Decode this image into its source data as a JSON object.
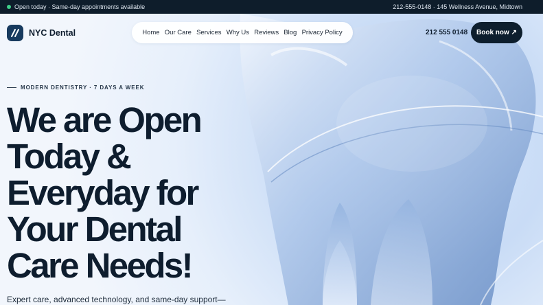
{
  "topbar": {
    "status": "Open today · Same-day appointments available",
    "contact": "212-555-0148 · 145 Wellness Avenue, Midtown"
  },
  "brand": {
    "name": "NYC Dental"
  },
  "nav": {
    "links": [
      "Home",
      "Our Care",
      "Services",
      "Why Us",
      "Reviews",
      "Blog",
      "Privacy Policy"
    ]
  },
  "header": {
    "phone": "212 555 0148",
    "book_label": "Book now ↗"
  },
  "hero": {
    "eyebrow": "MODERN DENTISTRY · 7 DAYS A WEEK",
    "headline": "We are Open Today & Everyday for Your Dental Care Needs!",
    "subtext": "Expert care, advanced technology, and same-day support—"
  },
  "colors": {
    "dark": "#0e1d2b",
    "accent_dot": "#3fd08a",
    "logo_bg": "#173a5e"
  },
  "icons": [
    "open-status-dot",
    "brand-logo-icon",
    "arrow-up-right-icon",
    "tooth-illustration"
  ]
}
